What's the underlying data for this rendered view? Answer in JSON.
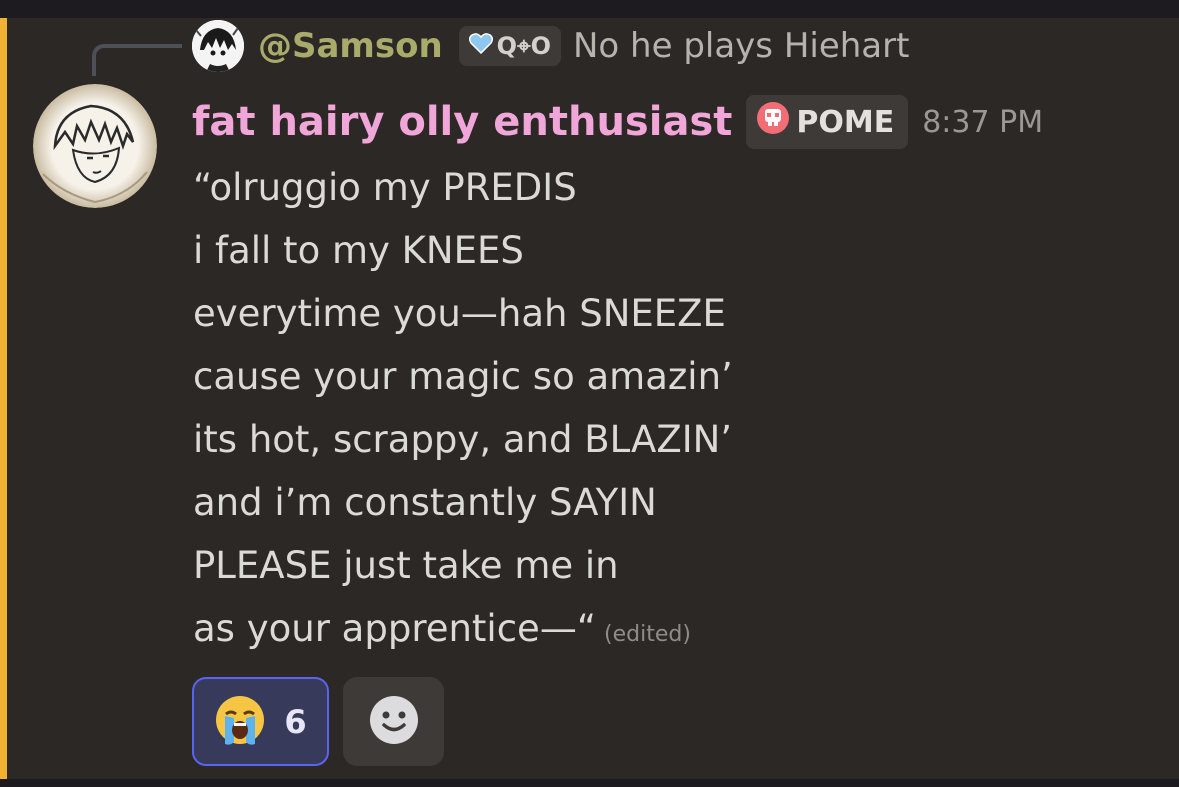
{
  "reply": {
    "author": "@Samson",
    "tag_label": "Q⌖O",
    "text": "No he plays Hiehart"
  },
  "message": {
    "author": "fat hairy olly enthusiast",
    "role_label": "POME",
    "timestamp": "8:37 PM",
    "lines": [
      "“olruggio my PREDIS",
      "i fall to my KNEES",
      "everytime you—hah SNEEZE",
      "cause your magic so amazin’",
      "its hot, scrappy, and BLAZIN’",
      "and i’m constantly SAYIN",
      "PLEASE just take me in",
      "as your apprentice—“"
    ],
    "edited_label": "(edited)"
  },
  "reactions": [
    {
      "emoji": "😭",
      "icon": "loudly-crying-face",
      "count": "6",
      "selected": true
    }
  ],
  "add_reaction": {
    "icon": "smiley-face-icon"
  },
  "colors": {
    "background": "#2c2825",
    "mention_bar": "#f0b232",
    "author": "#f0a6d8",
    "reply_author": "#a9ab6b",
    "reaction_selected_border": "#5865f2"
  }
}
